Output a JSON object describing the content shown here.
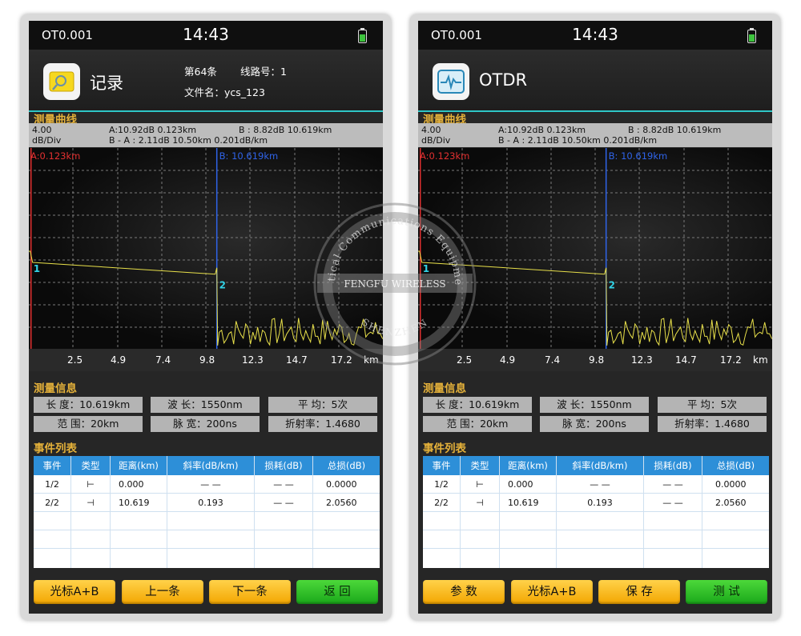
{
  "left": {
    "status": {
      "device": "OT0.001",
      "time": "14:43"
    },
    "header": {
      "title": "记录",
      "record": "第64条",
      "line_label": "线路号：1",
      "file": "文件名：ycs_123"
    },
    "buttons": [
      "光标A+B",
      "上一条",
      "下一条",
      "返 回"
    ]
  },
  "right": {
    "status": {
      "device": "OT0.001",
      "time": "14:43"
    },
    "header": {
      "title": "OTDR"
    },
    "buttons": [
      "参 数",
      "光标A+B",
      "保 存",
      "测 试"
    ]
  },
  "shared": {
    "measure_curve_title": "测量曲线",
    "scale": "4.00",
    "scale_unit": "dB/Div",
    "a_line": "A:10.92dB   0.123km",
    "b_line": "B : 8.82dB     10.619km",
    "ba_line": "B - A : 2.11dB         10.50km            0.201dB/km",
    "cursor_a_label": "A:0.123km",
    "cursor_b_label": "B: 10.619km",
    "event_marker_1": "1",
    "event_marker_2": "2",
    "x_ticks": [
      "2.5",
      "4.9",
      "7.4",
      "9.8",
      "12.3",
      "14.7",
      "17.2"
    ],
    "x_unit": "km",
    "info_title": "测量信息",
    "info": [
      "长 度：10.619km",
      "波 长：1550nm",
      "平 均：5次",
      "范 围：20km",
      "脉 宽：200ns",
      "折射率：1.4680"
    ],
    "events_title": "事件列表",
    "event_columns": [
      "事件",
      "类型",
      "距离(km)",
      "斜率(dB/km)",
      "损耗(dB)",
      "总损(dB)"
    ],
    "event_rows": [
      [
        "1/2",
        "⊢",
        "0.000",
        "— —",
        "— —",
        "0.0000"
      ],
      [
        "2/2",
        "⊣",
        "10.619",
        "0.193",
        "— —",
        "2.0560"
      ]
    ]
  },
  "trace": {
    "start_km": 0.123,
    "end_km": 10.619,
    "range_km": 20,
    "start_db": 10.92,
    "end_db": 8.82,
    "db_per_div": 4.0,
    "noise_seed": 7,
    "colors": {
      "trace": "#e8e04a",
      "cursor_a": "#e23030",
      "cursor_b": "#2f63e8",
      "grid": "#7a7a7a",
      "marker": "#32d2e6"
    }
  },
  "watermark": {
    "top_text": "Optical Communications Equipment",
    "middle_text": "FENGFU WIRELESS",
    "bottom_text": "SHENZHEN"
  }
}
